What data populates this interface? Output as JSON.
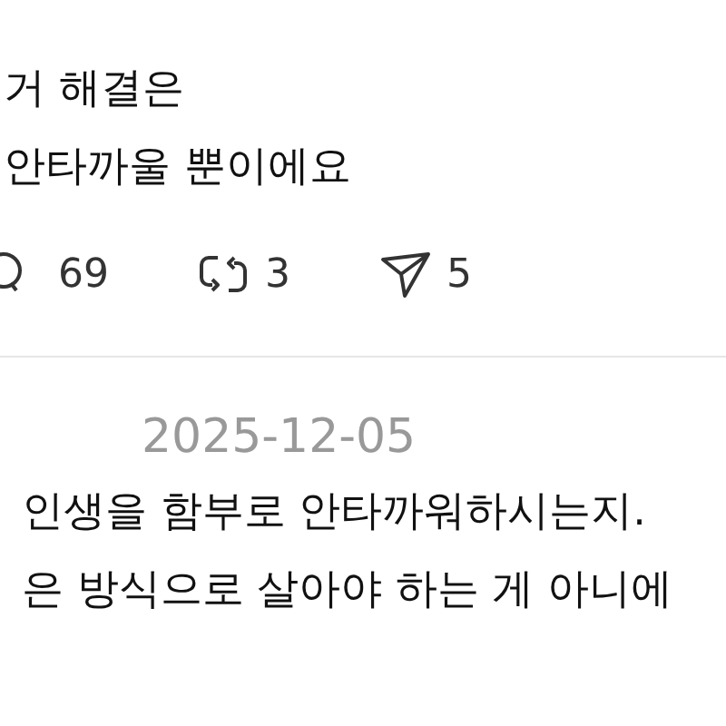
{
  "posts": [
    {
      "text_lines": [
        "거 해결은",
        "안타까울 뿐이에요"
      ],
      "actions": [
        {
          "kind": "comment",
          "count": "69"
        },
        {
          "kind": "repost",
          "count": "3"
        },
        {
          "kind": "share",
          "count": "5"
        }
      ]
    },
    {
      "date": "2025-12-05",
      "text_lines": [
        "인생을 함부로 안타까워하시는지.",
        "은 방식으로 살아야 하는 게 아니에"
      ]
    }
  ]
}
